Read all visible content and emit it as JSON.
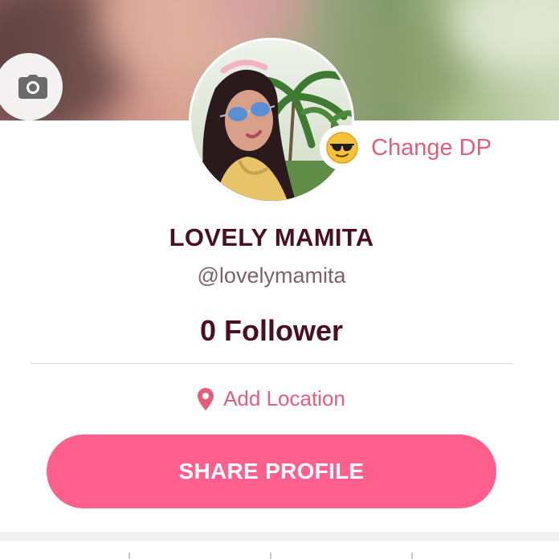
{
  "cover": {
    "photo": "blurred-cover-photo"
  },
  "camera": {
    "icon": "camera-icon"
  },
  "avatar": {
    "image": "profile-photo"
  },
  "change_dp": {
    "emoji": "sunglasses-emoji",
    "label": "Change DP"
  },
  "profile": {
    "name": "LOVELY MAMITA",
    "handle": "@lovelymamita",
    "followers": "0 Follower"
  },
  "location": {
    "icon": "location-pin-icon",
    "label": "Add Location"
  },
  "share": {
    "label": "SHARE PROFILE"
  },
  "colors": {
    "accent": "#e25f7c",
    "button": "#ff5f8d",
    "name_text": "#4a1020",
    "handle_text": "#7a6468"
  }
}
